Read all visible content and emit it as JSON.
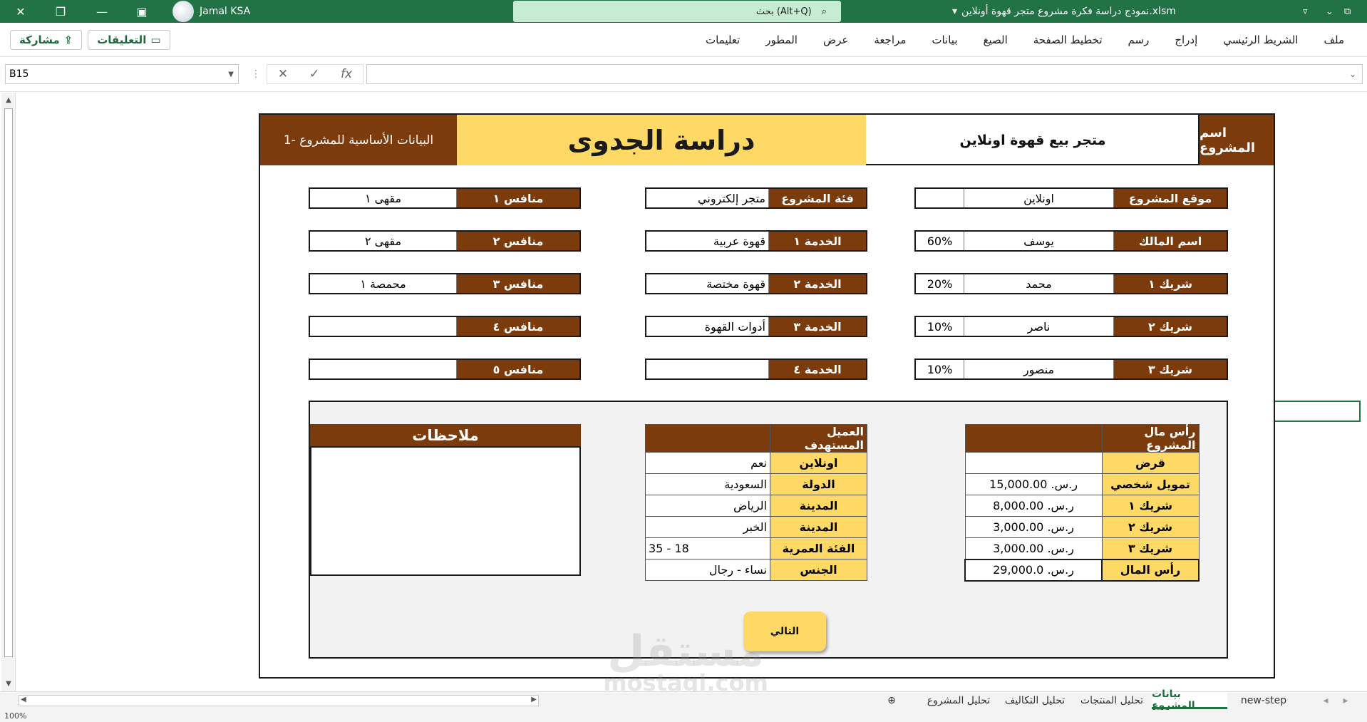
{
  "window": {
    "user_name": "Jamal KSA",
    "search_placeholder": "بحث (Alt+Q)",
    "file_name": "نموذج دراسة فكرة مشروع متجر قهوة أونلاين.xlsm",
    "file_dropdown": "▾"
  },
  "ribbon": {
    "share_label": "مشاركة",
    "comments_label": "التعليقات",
    "tabs": [
      "ملف",
      "الشريط الرئيسي",
      "إدراج",
      "رسم",
      "تخطيط الصفحة",
      "الصيغ",
      "بيانات",
      "مراجعة",
      "عرض",
      "المطور",
      "تعليمات"
    ]
  },
  "formula_bar": {
    "name_box": "B15",
    "formula": ""
  },
  "sheet": {
    "header_section": "البيانات الأساسية للمشروع -1",
    "title": "دراسة الجدوى",
    "project_name": "متجر بيع قهوة اونلاين",
    "project_name_label": "اسم المشروع",
    "right_fields": [
      {
        "label": "موقع المشروع",
        "value": "اونلاين",
        "pct": ""
      },
      {
        "label": "اسم المالك",
        "value": "يوسف",
        "pct": "60%"
      },
      {
        "label": "شريك ١",
        "value": "محمد",
        "pct": "20%"
      },
      {
        "label": "شريك ٢",
        "value": "ناصر",
        "pct": "10%"
      },
      {
        "label": "شريك ٣",
        "value": "منصور",
        "pct": "10%"
      }
    ],
    "middle_fields": [
      {
        "label": "فئة المشروع",
        "value": "متجر إلكتروني"
      },
      {
        "label": "الخدمة ١",
        "value": "قهوة عربية"
      },
      {
        "label": "الخدمة ٢",
        "value": "قهوة مختصة"
      },
      {
        "label": "الخدمة ٣",
        "value": "أدوات القهوة"
      },
      {
        "label": "الخدمة ٤",
        "value": ""
      }
    ],
    "left_fields": [
      {
        "label": "منافس ١",
        "value": "مقهى ١"
      },
      {
        "label": "منافس ٢",
        "value": "مقهى ٢"
      },
      {
        "label": "منافس ٣",
        "value": "محمصة ١"
      },
      {
        "label": "منافس ٤",
        "value": ""
      },
      {
        "label": "منافس ٥",
        "value": ""
      }
    ],
    "capital": {
      "title": "رأس مال المشروع",
      "rows": [
        {
          "label": "قرض",
          "value": ""
        },
        {
          "label": "تمويل شخصي",
          "value": "ر.س. 15,000.00"
        },
        {
          "label": "شريك ١",
          "value": "ر.س. 8,000.00"
        },
        {
          "label": "شريك ٢",
          "value": "ر.س. 3,000.00"
        },
        {
          "label": "شريك ٣",
          "value": "ر.س. 3,000.00"
        },
        {
          "label": "رأس المال",
          "value": "ر.س. 29,000.0"
        }
      ]
    },
    "target": {
      "title": "العميل المستهدف",
      "rows": [
        {
          "label": "اونلاين",
          "value": "نعم"
        },
        {
          "label": "الدولة",
          "value": "السعودية"
        },
        {
          "label": "المدينة",
          "value": "الرياض"
        },
        {
          "label": "المدينة",
          "value": "الخبر"
        },
        {
          "label": "الفئة العمرية",
          "value": "18 - 35"
        },
        {
          "label": "الجنس",
          "value": "نساء - رجال"
        }
      ]
    },
    "notes_title": "ملاحظات",
    "next_button": "التالي"
  },
  "watermark": {
    "word": "مستقل",
    "site": "mostaql.com"
  },
  "sheet_tabs": [
    "new-step",
    "بيانات المشروع",
    "تحليل المنتجات",
    "تحليل التكاليف",
    "تحليل المشروع"
  ],
  "status": {
    "zoom": "100%"
  },
  "colors": {
    "excel_green": "#217346",
    "brown": "#7b3b0c",
    "yellow": "#ffd966"
  }
}
